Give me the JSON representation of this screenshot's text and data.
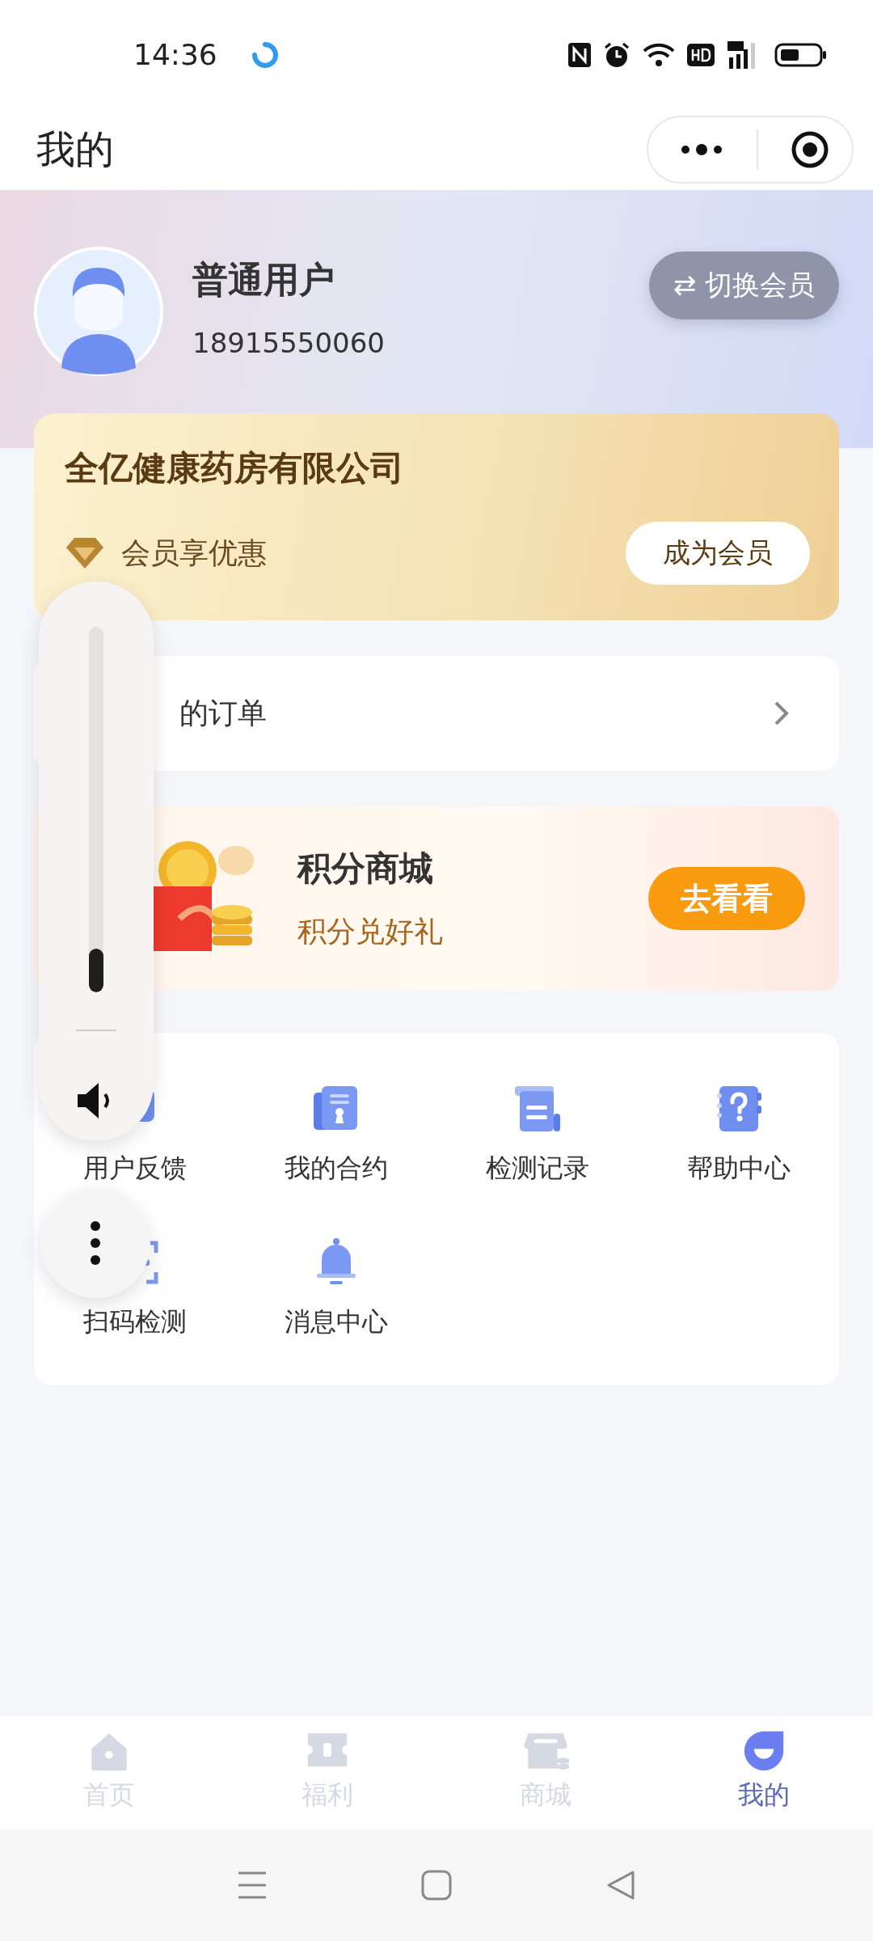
{
  "status_bar": {
    "time": "14:36"
  },
  "title_bar": {
    "title": "我的"
  },
  "profile": {
    "name": "普通用户",
    "phone": "18915550060",
    "switch_button": "⇄ 切换会员"
  },
  "member_card": {
    "company": "全亿健康药房有限公司",
    "benefit": "会员享优惠",
    "join_button": "成为会员"
  },
  "orders": {
    "label": "的订单"
  },
  "points_mall": {
    "title": "积分商城",
    "subtitle": "积分兑好礼",
    "button": "去看看"
  },
  "services": [
    {
      "label": "用户反馈"
    },
    {
      "label": "我的合约"
    },
    {
      "label": "检测记录"
    },
    {
      "label": "帮助中心"
    },
    {
      "label": "扫码检测"
    },
    {
      "label": "消息中心"
    }
  ],
  "tab_bar": [
    {
      "label": "首页",
      "selected": false
    },
    {
      "label": "福利",
      "selected": false
    },
    {
      "label": "商城",
      "selected": false
    },
    {
      "label": "我的",
      "selected": true
    }
  ],
  "volume_panel": {
    "level": 0.12
  }
}
